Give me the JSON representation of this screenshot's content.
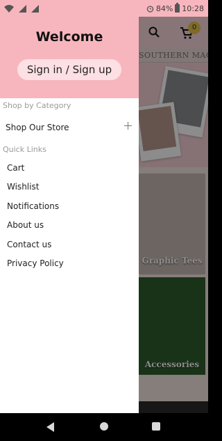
{
  "status_bar": {
    "battery": "84%",
    "time": "10:28"
  },
  "app_behind": {
    "brand": "SOUTHERN MAGNOLIA",
    "cart_count": "0",
    "tiles": [
      {
        "label": "Graphic Tees"
      },
      {
        "label": "Accessories"
      }
    ]
  },
  "drawer": {
    "welcome": "Welcome",
    "signin_label": "Sign in / Sign up",
    "shop_by_category": "Shop by Category",
    "shop_our_store": "Shop Our Store",
    "quick_links_title": "Quick Links",
    "quick_links": [
      "Cart",
      "Wishlist",
      "Notifications",
      "About us",
      "Contact us",
      "Privacy Policy"
    ]
  },
  "colors": {
    "drawer_header": "#f7b6bd",
    "signin_button": "#fde0e3",
    "badge": "#e7c24a"
  }
}
